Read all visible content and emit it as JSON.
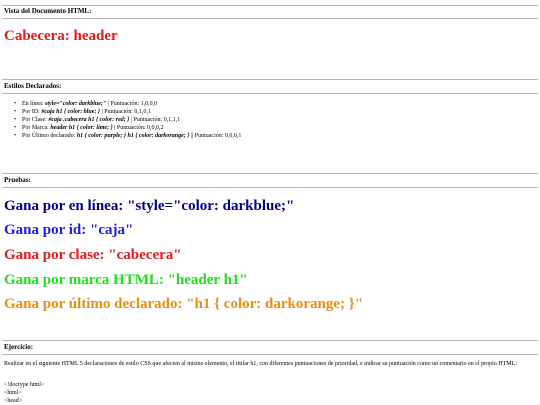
{
  "sections": {
    "vista": {
      "title": "Vista del Documento HTML:",
      "header_text": "Cabecera: header",
      "header_color": "#e31a1c"
    },
    "estilos": {
      "title": "Estilos Declarados:",
      "items": [
        {
          "label": "En línea: ",
          "rule": "style=\"color: darkblue;\"",
          "score": " | Puntuación: 1,0,0,0"
        },
        {
          "label": "Por ID: ",
          "rule": "#caja h1 { color: blue; }",
          "score": " | Puntuación: 0,1,0,1"
        },
        {
          "label": "Por Clase: ",
          "rule": "#caja .cabecera h1 { color: red; }",
          "score": " | Puntuación: 0,1,1,1"
        },
        {
          "label": "Por Marca: ",
          "rule": "header h1 { color: lime; }",
          "score": " | Puntuación: 0,0,0,2"
        },
        {
          "label": "Por Último declarado: ",
          "rule": "h1 { color: purple; } h1 { color: darkorange; }",
          "score": " || Puntuación: 0,0,0,1"
        }
      ]
    },
    "pruebas": {
      "title": "Pruebas:",
      "lines": [
        {
          "text": "Gana por en línea: \"style=\"color: darkblue;\"",
          "color": "#00008b"
        },
        {
          "text": "Gana por id: \"caja\"",
          "color": "#1c1ce3"
        },
        {
          "text": "Gana por clase: \"cabecera\"",
          "color": "#e31a1c"
        },
        {
          "text": "Gana por marca HTML: \"header h1\"",
          "color": "#19e319"
        },
        {
          "text": "Gana por último declarado: \"h1 { color: darkorange; }\"",
          "color": "#ef8c0b"
        }
      ]
    },
    "ejercicio": {
      "title": "Ejercicio:",
      "description": "Realizar en el siguiente HTML 5 declaraciones de estilo CSS que afecten al mismo elemento, el titilar h1, con diferentes puntuaciones de prioridad, e indicar su puntuación como un comentario en el propio HTML:",
      "code": [
        "<!doctype html>",
        "<html>",
        "<head>"
      ]
    }
  },
  "icons": {
    "bullet": "•"
  }
}
